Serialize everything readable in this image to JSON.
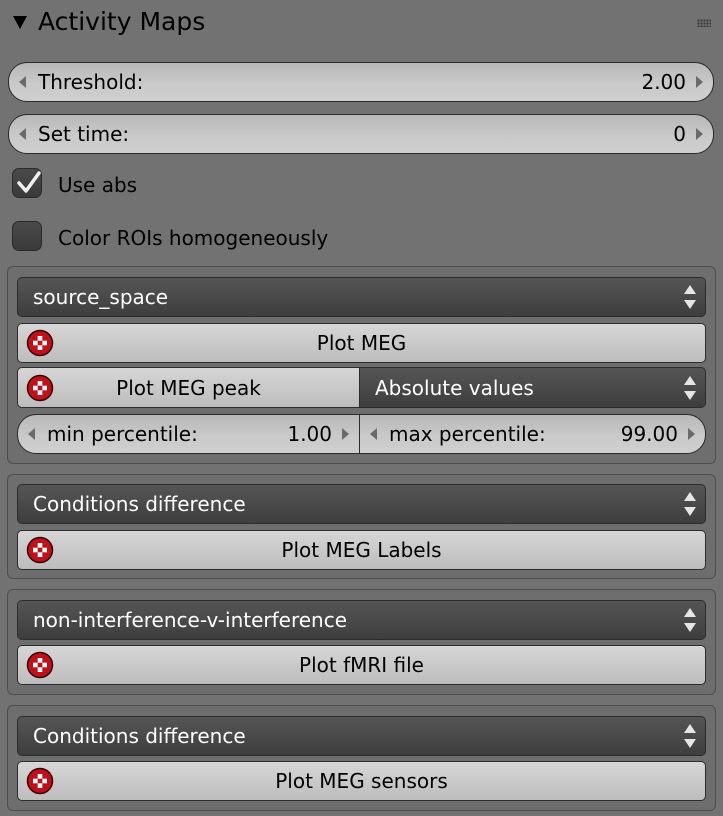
{
  "panel": {
    "title": "Activity Maps"
  },
  "threshold": {
    "label": "Threshold:",
    "value": "2.00"
  },
  "set_time": {
    "label": "Set time:",
    "value": "0"
  },
  "use_abs": {
    "label": "Use abs",
    "checked": true
  },
  "color_rois": {
    "label": "Color ROIs homogeneously",
    "checked": false
  },
  "meg_box": {
    "dropdown": "source_space",
    "plot_button": "Plot MEG",
    "peak_button": "Plot MEG peak",
    "values_dropdown": "Absolute values",
    "min_percentile": {
      "label": "min percentile:",
      "value": "1.00"
    },
    "max_percentile": {
      "label": "max percentile:",
      "value": "99.00"
    }
  },
  "labels_box": {
    "dropdown": "Conditions difference",
    "plot_button": "Plot MEG Labels"
  },
  "fmri_box": {
    "dropdown": "non-interference-v-interference",
    "plot_button": "Plot fMRI file"
  },
  "sensors_box": {
    "dropdown": "Conditions difference",
    "plot_button": "Plot MEG sensors"
  },
  "colors": {
    "panel_bg": "#727272",
    "dropdown_bg": "#3e3e3e",
    "button_bg": "#c9c9c9",
    "icon_red": "#c0101a"
  },
  "icons": {
    "header": "triangle-down-icon",
    "grip": "drag-grip-icon",
    "check": "checkmark-icon",
    "button": "render-checker-icon",
    "dropdown": "up-down-arrows-icon"
  }
}
